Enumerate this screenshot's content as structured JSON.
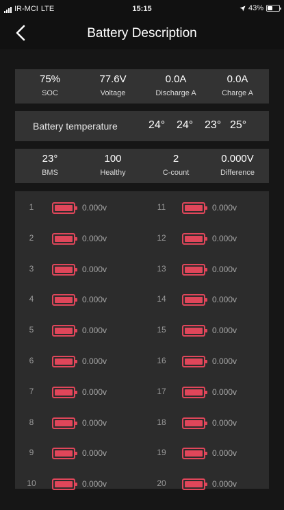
{
  "status_bar": {
    "carrier": "IR-MCI",
    "network": "LTE",
    "time": "15:15",
    "battery_percent": "43%",
    "battery_level": 0.43,
    "icons": [
      "signal-icon",
      "location-arrow-icon",
      "battery-icon"
    ]
  },
  "nav": {
    "title": "Battery Description",
    "back_icon": "chevron-left-icon"
  },
  "stats_top": [
    {
      "value": "75%",
      "label": "SOC"
    },
    {
      "value": "77.6V",
      "label": "Voltage"
    },
    {
      "value": "0.0A",
      "label": "Discharge A"
    },
    {
      "value": "0.0A",
      "label": "Charge A"
    }
  ],
  "temperature": {
    "label": "Battery temperature",
    "values": [
      "24°",
      "24°",
      "23°",
      "25°"
    ]
  },
  "stats_bottom": [
    {
      "value": "23°",
      "label": "BMS"
    },
    {
      "value": "100",
      "label": "Healthy"
    },
    {
      "value": "2",
      "label": "C-count"
    },
    {
      "value": "0.000V",
      "label": "Difference"
    }
  ],
  "cells": [
    {
      "index": "1",
      "voltage": "0.000v"
    },
    {
      "index": "2",
      "voltage": "0.000v"
    },
    {
      "index": "3",
      "voltage": "0.000v"
    },
    {
      "index": "4",
      "voltage": "0.000v"
    },
    {
      "index": "5",
      "voltage": "0.000v"
    },
    {
      "index": "6",
      "voltage": "0.000v"
    },
    {
      "index": "7",
      "voltage": "0.000v"
    },
    {
      "index": "8",
      "voltage": "0.000v"
    },
    {
      "index": "9",
      "voltage": "0.000v"
    },
    {
      "index": "10",
      "voltage": "0.000v"
    },
    {
      "index": "11",
      "voltage": "0.000v"
    },
    {
      "index": "12",
      "voltage": "0.000v"
    },
    {
      "index": "13",
      "voltage": "0.000v"
    },
    {
      "index": "14",
      "voltage": "0.000v"
    },
    {
      "index": "15",
      "voltage": "0.000v"
    },
    {
      "index": "16",
      "voltage": "0.000v"
    },
    {
      "index": "17",
      "voltage": "0.000v"
    },
    {
      "index": "18",
      "voltage": "0.000v"
    },
    {
      "index": "19",
      "voltage": "0.000v"
    },
    {
      "index": "20",
      "voltage": "0.000v"
    }
  ],
  "cell_icon": "battery-cell-icon",
  "colors": {
    "background": "#161616",
    "panel": "#333333",
    "cell_panel": "#2c2c2c",
    "cell_battery": "#e0465a"
  }
}
